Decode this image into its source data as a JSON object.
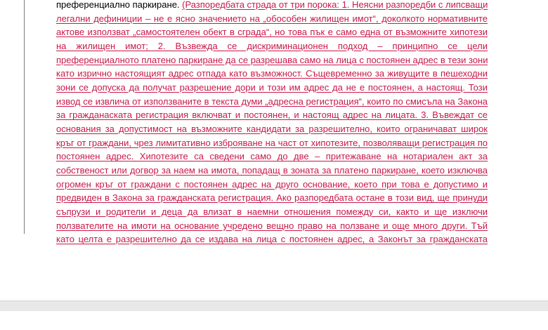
{
  "document": {
    "first_line_plain": "преференциално паркиране. ",
    "first_line_insert": "(Разпоредбата страда от три порока: 1. Неясни разпоредби с липсващи",
    "lines": [
      "легални дефиниции – не е ясно значението на „обособен жилищен имот“, доколкото нормативните",
      "актове използват „самостоятелен обект в сграда“, но това пък е само една от възможните хипотези",
      "на жилищен имот; 2. Възвежда се дискриминационен подход – принципно се цели",
      "преференциалното платено паркиране да се разрешава само на лица с постоянен адрес в тези зони,",
      "като изрично настоящият адрес отпада като възможност. Същевременно за живущите в пешеходни",
      "зони се допуска да получат разрешение дори и този им адрес да не е постоянен, а настоящ. Този",
      "извод се извлича от използваните в текста думи „адресна регистрация“, които по смисъла на Закона",
      "за гражданаската регистрация включват и постоянен, и настоящ адрес на лицата. 3. Въвеждат се",
      "основания за допустимост на възможните кандидати за разрешително, които ограничават широк",
      "кръг от граждани, чрез лимитативно изброяване на част от хипотезите, позволяващи регистрация по",
      "постоянен адрес. Хипотезите са сведени само до две – притежаване на нотариален акт за",
      "собственост или догвор за наем на имота, попадащ в зоната за платено паркиране, което изключва",
      "огромен кръг от граждани с постоянен адрес на друго основание, което при това е допустимо и",
      "предвиден в Закона за гражданската регистрация. Ако разпоредбата остане в този вид, ще принуди",
      "съпрузи и родители и деца да влизат в наемни отношения помежду си, както и ще изключи",
      "ползвателите на имоти на основание учредено вещно право на ползване и още много други. Тъй",
      "като целта е разрешително да се издава на лица с постоянен адрес, а Законът за гражданската"
    ]
  },
  "colors": {
    "insertion": "#c8194a",
    "text": "#000000",
    "margin_bar": "#7a7a7a",
    "statusbar": "#e8e8e8"
  }
}
